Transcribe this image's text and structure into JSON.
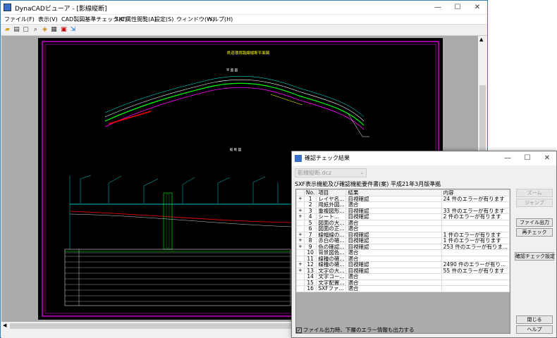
{
  "main": {
    "title": "DynaCADビューア - [影線縦断]",
    "menu": [
      {
        "label": "ファイル(F)"
      },
      {
        "label": "表示(V)"
      },
      {
        "label": "CAD製図基準チェック(C)"
      },
      {
        "label": "SXF属性閲覧(A)"
      },
      {
        "label": "設定(S)"
      },
      {
        "label": "ウィンドウ(W)"
      },
      {
        "label": "ヘルプ(H)"
      }
    ],
    "toolbar_icons": [
      "open-icon",
      "print-icon",
      "preview-icon",
      "zoom-icon",
      "layer-icon",
      "attribute-icon",
      "check-icon",
      "export-icon"
    ],
    "window_buttons": {
      "minimize": "—",
      "maximize": "☐",
      "close": "✕"
    }
  },
  "drawing": {
    "title": "県道環境路線縦断平面図",
    "subtitle": "平 面 図",
    "profile_title": "縦 断 図",
    "colors": {
      "frame": "#ff00ff",
      "cyan": "#00ffff",
      "green": "#00ff00",
      "yellow": "#ffff00",
      "red": "#ff0000",
      "white": "#ffffff"
    }
  },
  "dialog": {
    "title": "確認チェック結果",
    "select_value": "影線縦断.dcz",
    "header": "SXF表示機能及び確認機能要件書(案) 平成21年3月版準拠",
    "columns": [
      "No.",
      "項目",
      "結果",
      "内容"
    ],
    "rows": [
      {
        "expand": "+",
        "no": "1",
        "item": "レイヤ名...",
        "result": "目視確認",
        "detail": "24 件のエラーが有ります"
      },
      {
        "expand": "",
        "no": "2",
        "item": "用紙外図...",
        "result": "適合",
        "detail": ""
      },
      {
        "expand": "+",
        "no": "3",
        "item": "重複図形...",
        "result": "目視確認",
        "detail": "33 件のエラーが有ります"
      },
      {
        "expand": "+",
        "no": "4",
        "item": "シート...",
        "result": "目視確認",
        "detail": "2 件のエラーが有ります"
      },
      {
        "expand": "",
        "no": "5",
        "item": "図面の大...",
        "result": "適合",
        "detail": ""
      },
      {
        "expand": "",
        "no": "6",
        "item": "図面の正...",
        "result": "適合",
        "detail": ""
      },
      {
        "expand": "+",
        "no": "7",
        "item": "線幅線の...",
        "result": "目視確認",
        "detail": "1 件のエラーが有ります"
      },
      {
        "expand": "+",
        "no": "8",
        "item": "赤白の確...",
        "result": "目視確認",
        "detail": "1 件のエラーが有ります"
      },
      {
        "expand": "+",
        "no": "9",
        "item": "色の確認...",
        "result": "目視確認",
        "detail": "253 件のエラーが有りま..."
      },
      {
        "expand": "",
        "no": "10",
        "item": "背景図色...",
        "result": "適合",
        "detail": ""
      },
      {
        "expand": "",
        "no": "11",
        "item": "線種の確...",
        "result": "適合",
        "detail": ""
      },
      {
        "expand": "+",
        "no": "12",
        "item": "線種の確...",
        "result": "目視確認",
        "detail": "2490 件のエラーが有り..."
      },
      {
        "expand": "+",
        "no": "13",
        "item": "文字の大...",
        "result": "目視確認",
        "detail": "55 件のエラーが有ります"
      },
      {
        "expand": "",
        "no": "14",
        "item": "文字コー...",
        "result": "適合",
        "detail": ""
      },
      {
        "expand": "",
        "no": "15",
        "item": "文字配置...",
        "result": "適合",
        "detail": ""
      },
      {
        "expand": "",
        "no": "16",
        "item": "SXFファ...",
        "result": "適合",
        "detail": ""
      }
    ],
    "buttons": {
      "zoom": "ズーム",
      "jump": "ジャンプ",
      "file_output": "ファイル出力",
      "recheck": "再チェック",
      "check_settings": "確認チェック設定",
      "close": "閉じる",
      "help": "ヘルプ"
    },
    "footer_checkbox": {
      "checked": true,
      "label": "ファイル出力時、下層のエラー情報も出力する"
    },
    "window_buttons": {
      "minimize": "—",
      "maximize": "☐",
      "close": "✕"
    }
  }
}
